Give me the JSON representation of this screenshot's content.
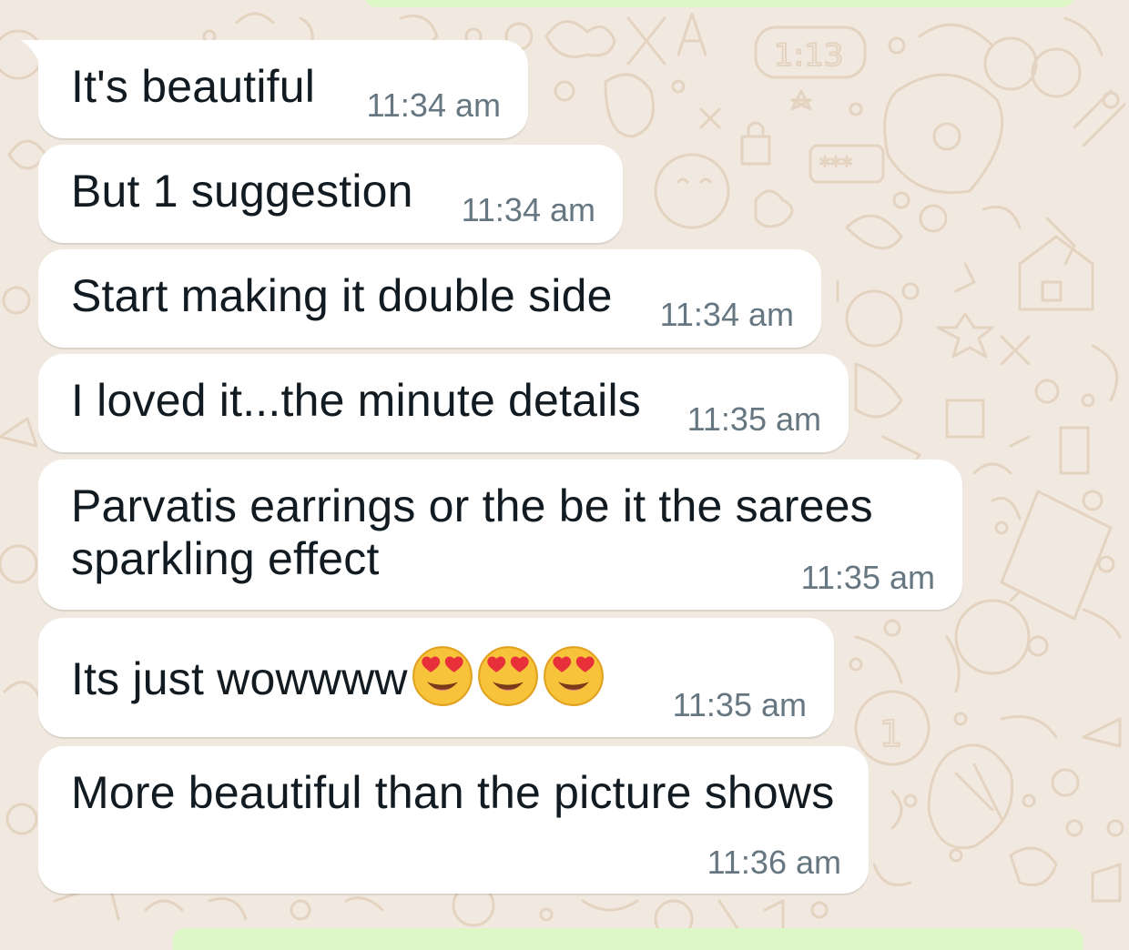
{
  "messages": [
    {
      "text": "It's beautiful",
      "time": "11:34 am"
    },
    {
      "text": "But 1 suggestion",
      "time": "11:34 am"
    },
    {
      "text": "Start making it double side",
      "time": "11:34 am"
    },
    {
      "text": "I loved it...the minute details",
      "time": "11:35 am"
    },
    {
      "line1": "Parvatis earrings or the be it the sarees",
      "line2": "sparkling effect",
      "time": "11:35 am"
    },
    {
      "text": "Its just wowwww",
      "emoji": "heart-eyes-emoji",
      "emoji_count": 3,
      "time": "11:35 am"
    },
    {
      "text": "More beautiful than the picture shows",
      "time": "11:36 am"
    }
  ],
  "colors": {
    "wallpaper": "#f1e9df",
    "incoming_bubble": "#ffffff",
    "outgoing_bubble": "#dcf7c5",
    "text": "#111b21",
    "timestamp": "#667781"
  }
}
